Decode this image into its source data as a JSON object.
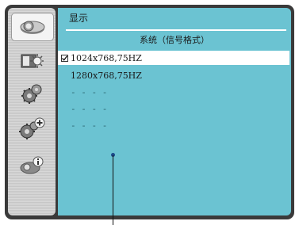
{
  "panel": {
    "title": "显示",
    "subtitle": "系统（信号格式）"
  },
  "sidebar": {
    "tabs": [
      {
        "icon": "projector-icon",
        "active": true
      },
      {
        "icon": "screen-adjust-icon",
        "active": false
      },
      {
        "icon": "settings-gear-icon",
        "active": false
      },
      {
        "icon": "advanced-settings-icon",
        "active": false
      },
      {
        "icon": "info-icon",
        "active": false
      }
    ]
  },
  "list": {
    "items": [
      {
        "label": "1024x768,75HZ",
        "checked": true
      },
      {
        "label": "1280x768,75HZ",
        "checked": false
      },
      {
        "label": "- - - -",
        "checked": false
      },
      {
        "label": "- - - -",
        "checked": false
      },
      {
        "label": "- - - -",
        "checked": false
      }
    ]
  },
  "colors": {
    "panel_bg": "#6bc3d2",
    "frame": "#3a3a3a",
    "sidebar": "#cfcfcf",
    "selected_row": "#ffffff"
  }
}
